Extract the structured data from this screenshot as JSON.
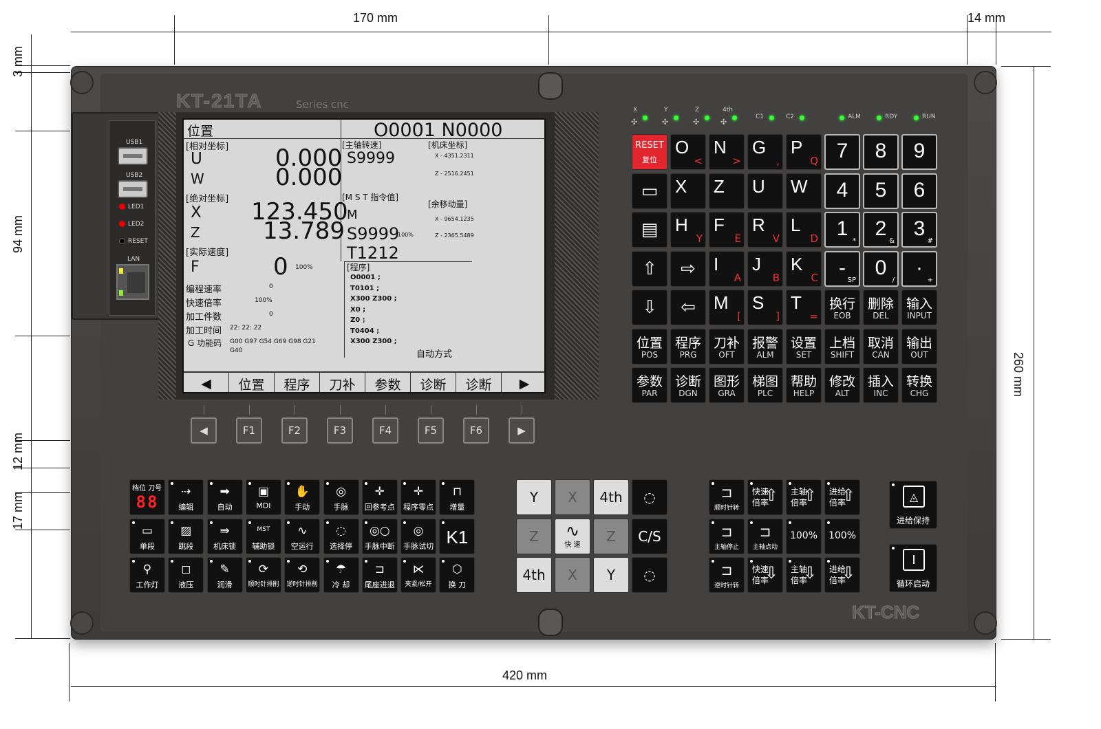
{
  "dimensions": {
    "top_left": "170 mm",
    "top_right": "14 mm",
    "bottom": "420 mm",
    "right": "260 mm",
    "left_3": "3 mm",
    "left_94": "94 mm",
    "left_12": "12 mm",
    "left_17": "17 mm"
  },
  "brand": {
    "model": "KT-21TA",
    "series": "Series cnc",
    "footer_logo": "KT-CNC"
  },
  "usb": {
    "usb1": "USB1",
    "usb2": "USB2",
    "led1": "LED1",
    "led2": "LED2",
    "reset": "RESET",
    "lan": "LAN"
  },
  "screen": {
    "title": "位置",
    "prog_header": "O0001 N0000",
    "rel_header": "[相对坐标]",
    "rel": [
      {
        "axis": "U",
        "value": "0.000"
      },
      {
        "axis": "W",
        "value": "0.000"
      }
    ],
    "abs_header": "[绝对坐标]",
    "abs": [
      {
        "axis": "X",
        "value": "123.450"
      },
      {
        "axis": "Z",
        "value": "13.789"
      }
    ],
    "speed_header": "[实际速度]",
    "feed_axis": "F",
    "feed_value": "0",
    "feed_pct": "100%",
    "stats": [
      {
        "label": "编程速率",
        "value": "0"
      },
      {
        "label": "快速倍率",
        "value": "100%"
      },
      {
        "label": "加工件数",
        "value": "0"
      },
      {
        "label": "加工时间",
        "value": "22: 22: 22"
      }
    ],
    "gcode_label": "G 功能码",
    "gcode_values": "G00 G97 G54 G69 G98 G21",
    "gcode_values2": "G40",
    "spindle_header": "[主轴转速]",
    "spindle_value": "S9999",
    "machine_header": "[机床坐标]",
    "machine_x": "X - 4351.2311",
    "machine_z": "Z - 2516.2451",
    "mst_header": "[M S T 指令值]",
    "mst_m": "M",
    "mst_s": "S9999",
    "mst_s_pct": "100%",
    "mst_t": "T1212",
    "remain_header": "[余移动量]",
    "remain_x": "X - 9654.1235",
    "remain_z": "Z - 2365.5489",
    "program_header": "[程序]",
    "program_lines": [
      "O0001 ;",
      "T0101 ;",
      "X300 Z300 ;",
      "X0 ;",
      "Z0 ;",
      "T0404 ;",
      "X300 Z300 ;"
    ],
    "mode": "自动方式",
    "softkeys": [
      "◀",
      "位置",
      "程序",
      "刀补",
      "参数",
      "诊断",
      "诊断",
      "▶"
    ]
  },
  "fkeys": [
    "◀",
    "F1",
    "F2",
    "F3",
    "F4",
    "F5",
    "F6",
    "▶"
  ],
  "axis_leds": [
    "X",
    "Y",
    "Z",
    "4th",
    "C1",
    "C2"
  ],
  "status_leds": [
    "ALM",
    "RDY",
    "RUN"
  ],
  "keypad": [
    [
      {
        "type": "reset",
        "zh": "RESET",
        "en": "复位"
      },
      {
        "type": "az",
        "m": "O",
        "s": "<"
      },
      {
        "type": "az",
        "m": "N",
        "s": ">"
      },
      {
        "type": "az",
        "m": "G",
        "s": ","
      },
      {
        "type": "az",
        "m": "P",
        "s": "Q"
      },
      {
        "type": "num",
        "m": "7"
      },
      {
        "type": "num",
        "m": "8"
      },
      {
        "type": "num",
        "m": "9"
      }
    ],
    [
      {
        "type": "icon",
        "m": "▭"
      },
      {
        "type": "az",
        "m": "X",
        "s": ""
      },
      {
        "type": "az",
        "m": "Z",
        "s": ""
      },
      {
        "type": "az",
        "m": "U",
        "s": ""
      },
      {
        "type": "az",
        "m": "W",
        "s": ""
      },
      {
        "type": "num",
        "m": "4"
      },
      {
        "type": "num",
        "m": "5"
      },
      {
        "type": "num",
        "m": "6"
      }
    ],
    [
      {
        "type": "icon",
        "m": "▤"
      },
      {
        "type": "az",
        "m": "H",
        "s": "Y"
      },
      {
        "type": "az",
        "m": "F",
        "s": "E"
      },
      {
        "type": "az",
        "m": "R",
        "s": "V"
      },
      {
        "type": "az",
        "m": "L",
        "s": "D"
      },
      {
        "type": "num",
        "m": "1",
        "s": "*"
      },
      {
        "type": "num",
        "m": "2",
        "s": "&"
      },
      {
        "type": "num",
        "m": "3",
        "s": "#"
      }
    ],
    [
      {
        "type": "icon",
        "m": "⇧"
      },
      {
        "type": "icon",
        "m": "⇨"
      },
      {
        "type": "az",
        "m": "I",
        "s": "A"
      },
      {
        "type": "az",
        "m": "J",
        "s": "B"
      },
      {
        "type": "az",
        "m": "K",
        "s": "C"
      },
      {
        "type": "num",
        "m": "-",
        "s": "SP"
      },
      {
        "type": "num",
        "m": "0",
        "s": "/"
      },
      {
        "type": "num",
        "m": "·",
        "s": "+"
      }
    ],
    [
      {
        "type": "icon",
        "m": "⇩"
      },
      {
        "type": "icon",
        "m": "⇦"
      },
      {
        "type": "az",
        "m": "M",
        "s": "["
      },
      {
        "type": "az",
        "m": "S",
        "s": "]"
      },
      {
        "type": "az",
        "m": "T",
        "s": "="
      },
      {
        "type": "fn",
        "zh": "换行",
        "en": "EOB"
      },
      {
        "type": "fn",
        "zh": "删除",
        "en": "DEL"
      },
      {
        "type": "fn",
        "zh": "输入",
        "en": "INPUT"
      }
    ],
    [
      {
        "type": "fn",
        "zh": "位置",
        "en": "POS"
      },
      {
        "type": "fn",
        "zh": "程序",
        "en": "PRG"
      },
      {
        "type": "fn",
        "zh": "刀补",
        "en": "OFT"
      },
      {
        "type": "fn",
        "zh": "报警",
        "en": "ALM"
      },
      {
        "type": "fn",
        "zh": "设置",
        "en": "SET"
      },
      {
        "type": "fn",
        "zh": "上档",
        "en": "SHIFT"
      },
      {
        "type": "fn",
        "zh": "取消",
        "en": "CAN"
      },
      {
        "type": "fn",
        "zh": "输出",
        "en": "OUT"
      }
    ],
    [
      {
        "type": "fn",
        "zh": "参数",
        "en": "PAR"
      },
      {
        "type": "fn",
        "zh": "诊断",
        "en": "DGN"
      },
      {
        "type": "fn",
        "zh": "图形",
        "en": "GRA"
      },
      {
        "type": "fn",
        "zh": "梯图",
        "en": "PLC"
      },
      {
        "type": "fn",
        "zh": "帮助",
        "en": "HELP"
      },
      {
        "type": "fn",
        "zh": "修改",
        "en": "ALT"
      },
      {
        "type": "fn",
        "zh": "插入",
        "en": "INC"
      },
      {
        "type": "fn",
        "zh": "转换",
        "en": "CHG"
      }
    ]
  ],
  "mode_keys": [
    [
      {
        "ic": "",
        "lb": "档位 刀号",
        "disp": "88"
      },
      {
        "ic": "⇢",
        "lb": "编辑"
      },
      {
        "ic": "➡",
        "lb": "自动"
      },
      {
        "ic": "▣",
        "lb": "MDI"
      },
      {
        "ic": "✋",
        "lb": "手动"
      },
      {
        "ic": "◎",
        "lb": "手脉"
      },
      {
        "ic": "✛",
        "lb": "回参考点"
      },
      {
        "ic": "✛",
        "lb": "程序零点"
      },
      {
        "ic": "⊓",
        "lb": "增量"
      }
    ],
    [
      {
        "ic": "▭",
        "lb": "单段"
      },
      {
        "ic": "▨",
        "lb": "跳段"
      },
      {
        "ic": "⇛",
        "lb": "机床锁"
      },
      {
        "ic": "MST",
        "lb": "辅助锁"
      },
      {
        "ic": "∿",
        "lb": "空运行"
      },
      {
        "ic": "◌",
        "lb": "选择停"
      },
      {
        "ic": "◎○",
        "lb": "手脉中断"
      },
      {
        "ic": "◎",
        "lb": "手脉试切"
      },
      {
        "ic": "K1",
        "lb": ""
      }
    ],
    [
      {
        "ic": "⚲",
        "lb": "工作灯"
      },
      {
        "ic": "◻",
        "lb": "液压"
      },
      {
        "ic": "✎",
        "lb": "润滑"
      },
      {
        "ic": "⟳",
        "lb": "顺时针排削"
      },
      {
        "ic": "⟲",
        "lb": "逆时针排削"
      },
      {
        "ic": "☂",
        "lb": "冷 却"
      },
      {
        "ic": "⊐",
        "lb": "尾座进退"
      },
      {
        "ic": "⋉",
        "lb": "夹紧/松开"
      },
      {
        "ic": "⬡",
        "lb": "换 刀"
      }
    ]
  ],
  "jog": {
    "y_minus": "Y",
    "x_plus": "X",
    "fourth_plus": "4th",
    "spindle_cw": "◌",
    "z_minus": "Z",
    "rapid": "快 速",
    "z_plus": "Z",
    "cs": "C/S",
    "fourth_minus": "4th",
    "x_minus": "X",
    "y_plus": "Y",
    "spindle_ccw": "◌"
  },
  "override": [
    [
      {
        "type": "ar",
        "tx": "",
        "lb": "顺时针转",
        "ar": "⊐"
      },
      {
        "type": "txar",
        "tx": "快速\n倍率",
        "ar": "⇧"
      },
      {
        "type": "txar",
        "tx": "主轴\n倍率",
        "ar": "⇧"
      },
      {
        "type": "txar",
        "tx": "进给\n倍率",
        "ar": "⇧"
      }
    ],
    [
      {
        "type": "ar",
        "tx": "",
        "lb": "主轴停止",
        "ar": "⊐"
      },
      {
        "type": "ar",
        "tx": "",
        "lb": "主轴点动",
        "ar": "⊐"
      },
      {
        "type": "cen",
        "tx": "100%"
      },
      {
        "type": "cen",
        "tx": "100%"
      }
    ],
    [
      {
        "type": "ar",
        "tx": "",
        "lb": "逆时针转",
        "ar": "⊐"
      },
      {
        "type": "txar",
        "tx": "快速\n倍率",
        "ar": "⇩"
      },
      {
        "type": "txar",
        "tx": "主轴\n倍率",
        "ar": "⇩"
      },
      {
        "type": "txar",
        "tx": "进给\n倍率",
        "ar": "⇩"
      }
    ]
  ],
  "cycle": {
    "hold": "进给保持",
    "start": "循环启动"
  }
}
